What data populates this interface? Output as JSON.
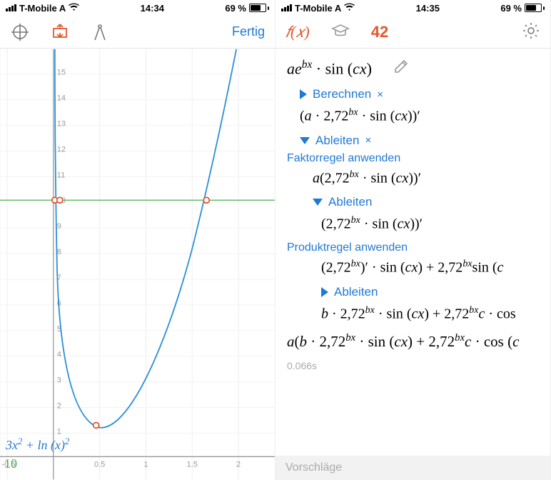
{
  "status_left": {
    "carrier": "T-Mobile A",
    "time": "14:34",
    "battery_text": "69 %"
  },
  "status_right": {
    "carrier": "T-Mobile A",
    "time": "14:35",
    "battery_text": "69 %"
  },
  "left_toolbar": {
    "done": "Fertig"
  },
  "graph_formula": "3x² + ln (x)²",
  "slider_value": "10",
  "x_ticks": [
    "-0.5",
    "0.5",
    "1",
    "1.5",
    "2"
  ],
  "y_ticks": [
    "1",
    "2",
    "3",
    "4",
    "5",
    "6",
    "7",
    "8",
    "9",
    "10",
    "11",
    "12",
    "13",
    "14",
    "15"
  ],
  "right_tab": {
    "fx": "f(x)",
    "num": "42"
  },
  "main_expr": "aeᵇˣ · sin (cx)",
  "step_compute": {
    "label": "Berechnen",
    "close": "×",
    "expr": "(a · 2,72ᵇˣ · sin (cx))′"
  },
  "step_derive": {
    "label": "Ableiten",
    "close": "×"
  },
  "factor_rule": {
    "label": "Faktorregel anwenden",
    "expr": "a(2,72ᵇˣ · sin (cx))′"
  },
  "derive2": {
    "label": "Ableiten",
    "expr": "(2,72ᵇˣ · sin (cx))′"
  },
  "product_rule": {
    "label": "Produktregel anwenden",
    "expr": "(2,72ᵇˣ)′ · sin (cx) + 2,72ᵇˣsin (c"
  },
  "derive3": {
    "label": "Ableiten",
    "expr": "b · 2,72ᵇˣ · sin (cx) + 2,72ᵇˣc · cos "
  },
  "final_expr": "a(b · 2,72ᵇˣ · sin (cx) + 2,72ᵇˣc · cos (c",
  "timing": "0.066s",
  "suggestions": "Vorschläge",
  "accent": "#e4572e",
  "link_blue": "#2179d6",
  "chart_data": {
    "type": "line",
    "function": "3x^2 + ln(x)^2",
    "x_range": [
      -0.7,
      2.2
    ],
    "y_range": [
      -0.5,
      15.5
    ],
    "horizontal_guide": 10,
    "marked_points": [
      {
        "x": 0.02,
        "y": 10,
        "note": "left intercept with y=10"
      },
      {
        "x": 0.05,
        "y": 10,
        "note": "near-axis intercept"
      },
      {
        "x": 1.8,
        "y": 10,
        "note": "right intercept with y=10"
      },
      {
        "x": 0.45,
        "y": 1.2,
        "note": "local minimum"
      }
    ]
  }
}
